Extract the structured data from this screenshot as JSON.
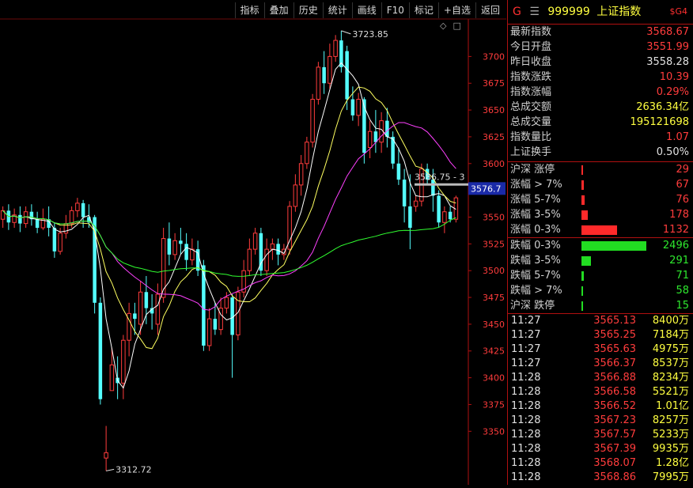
{
  "toolbar": {
    "buttons": [
      "指标",
      "叠加",
      "历史",
      "统计",
      "画线",
      "F10",
      "标记",
      "+自选",
      "返回"
    ]
  },
  "toolbar_icons": [
    "◇",
    "□"
  ],
  "chart": {
    "price_ticks": [
      "3700",
      "3675",
      "3650",
      "3625",
      "3600",
      "3575",
      "3550",
      "3525",
      "3500",
      "3475",
      "3450",
      "3425",
      "3400",
      "3375",
      "3350"
    ],
    "tick_values": [
      3700,
      3675,
      3650,
      3625,
      3600,
      3575,
      3550,
      3525,
      3500,
      3475,
      3450,
      3425,
      3400,
      3375,
      3350
    ],
    "high_label": "3723.85",
    "low_label": "3312.72",
    "cursor_label": "3586.75 - 3",
    "current_price_tag": "3576.7",
    "colors": {
      "up": "#ff3c3c",
      "down": "#54ffff",
      "ma5": "#ffffff",
      "ma10": "#ffff60",
      "ma20": "#ff40ff",
      "ma60": "#30ff30",
      "axis": "#b01010"
    }
  },
  "chart_data": {
    "type": "candlestick",
    "ylim": [
      3300,
      3735
    ],
    "candles": [
      [
        3548,
        3556,
        3540,
        3560
      ],
      [
        3556,
        3545,
        3538,
        3562
      ],
      [
        3545,
        3552,
        3540,
        3558
      ],
      [
        3552,
        3544,
        3536,
        3560
      ],
      [
        3544,
        3555,
        3540,
        3560
      ],
      [
        3555,
        3548,
        3542,
        3562
      ],
      [
        3548,
        3540,
        3535,
        3555
      ],
      [
        3540,
        3548,
        3538,
        3558
      ],
      [
        3548,
        3540,
        3532,
        3560
      ],
      [
        3540,
        3518,
        3512,
        3545
      ],
      [
        3518,
        3535,
        3515,
        3540
      ],
      [
        3535,
        3544,
        3530,
        3552
      ],
      [
        3544,
        3556,
        3540,
        3560
      ],
      [
        3556,
        3563,
        3550,
        3568
      ],
      [
        3563,
        3550,
        3540,
        3566
      ],
      [
        3550,
        3545,
        3540,
        3562
      ],
      [
        3550,
        3470,
        3460,
        3552
      ],
      [
        3470,
        3380,
        3375,
        3475
      ],
      [
        3325,
        3330,
        3313,
        3355
      ],
      [
        3388,
        3412,
        3398,
        3428
      ],
      [
        3400,
        3395,
        3380,
        3420
      ],
      [
        3395,
        3435,
        3380,
        3440
      ],
      [
        3435,
        3460,
        3420,
        3470
      ],
      [
        3460,
        3455,
        3440,
        3470
      ],
      [
        3450,
        3480,
        3440,
        3490
      ],
      [
        3480,
        3465,
        3450,
        3495
      ],
      [
        3465,
        3460,
        3445,
        3478
      ],
      [
        3450,
        3478,
        3440,
        3488
      ],
      [
        3475,
        3530,
        3470,
        3540
      ],
      [
        3530,
        3515,
        3505,
        3545
      ],
      [
        3515,
        3528,
        3510,
        3535
      ],
      [
        3528,
        3525,
        3515,
        3540
      ],
      [
        3525,
        3510,
        3500,
        3535
      ],
      [
        3510,
        3520,
        3505,
        3530
      ],
      [
        3520,
        3500,
        3495,
        3528
      ],
      [
        3505,
        3430,
        3425,
        3510
      ],
      [
        3430,
        3455,
        3425,
        3465
      ],
      [
        3455,
        3445,
        3440,
        3470
      ],
      [
        3445,
        3465,
        3440,
        3475
      ],
      [
        3465,
        3475,
        3460,
        3480
      ],
      [
        3475,
        3440,
        3400,
        3478
      ],
      [
        3440,
        3480,
        3435,
        3485
      ],
      [
        3480,
        3500,
        3475,
        3510
      ],
      [
        3500,
        3520,
        3495,
        3530
      ],
      [
        3520,
        3535,
        3515,
        3540
      ],
      [
        3535,
        3500,
        3495,
        3540
      ],
      [
        3500,
        3520,
        3495,
        3530
      ],
      [
        3520,
        3525,
        3510,
        3530
      ],
      [
        3525,
        3515,
        3505,
        3530
      ],
      [
        3515,
        3520,
        3510,
        3525
      ],
      [
        3520,
        3560,
        3515,
        3565
      ],
      [
        3560,
        3580,
        3555,
        3590
      ],
      [
        3580,
        3600,
        3570,
        3608
      ],
      [
        3600,
        3620,
        3595,
        3625
      ],
      [
        3620,
        3660,
        3615,
        3665
      ],
      [
        3660,
        3690,
        3655,
        3695
      ],
      [
        3690,
        3675,
        3665,
        3705
      ],
      [
        3675,
        3700,
        3670,
        3712
      ],
      [
        3700,
        3715,
        3695,
        3720
      ],
      [
        3715,
        3690,
        3685,
        3724
      ],
      [
        3705,
        3660,
        3650,
        3710
      ],
      [
        3660,
        3645,
        3640,
        3672
      ],
      [
        3645,
        3660,
        3635,
        3666
      ],
      [
        3660,
        3610,
        3600,
        3662
      ],
      [
        3615,
        3630,
        3605,
        3640
      ],
      [
        3630,
        3620,
        3610,
        3650
      ],
      [
        3620,
        3640,
        3610,
        3648
      ],
      [
        3640,
        3625,
        3615,
        3652
      ],
      [
        3625,
        3600,
        3595,
        3630
      ],
      [
        3600,
        3585,
        3580,
        3615
      ],
      [
        3585,
        3560,
        3545,
        3595
      ],
      [
        3560,
        3540,
        3520,
        3590
      ],
      [
        3560,
        3565,
        3555,
        3570
      ],
      [
        3565,
        3595,
        3560,
        3600
      ],
      [
        3595,
        3585,
        3580,
        3600
      ],
      [
        3585,
        3570,
        3555,
        3595
      ],
      [
        3570,
        3545,
        3540,
        3575
      ],
      [
        3545,
        3555,
        3535,
        3560
      ],
      [
        3555,
        3548,
        3545,
        3560
      ],
      [
        3548,
        3568,
        3545,
        3570
      ]
    ]
  },
  "panel": {
    "header": {
      "prefix": "G",
      "menu": "☰",
      "code": "999999",
      "name": "上证指数",
      "tag": "$G4"
    },
    "quotes": [
      {
        "label": "最新指数",
        "value": "3568.67",
        "color": "red"
      },
      {
        "label": "今日开盘",
        "value": "3551.99",
        "color": "red"
      },
      {
        "label": "昨日收盘",
        "value": "3558.28",
        "color": "white"
      },
      {
        "label": "指数涨跌",
        "value": "10.39",
        "color": "red"
      },
      {
        "label": "指数涨幅",
        "value": "0.29%",
        "color": "red"
      },
      {
        "label": "总成交额",
        "value": "2636.34亿",
        "color": "yellow"
      },
      {
        "label": "总成交量",
        "value": "195121698",
        "color": "yellow"
      },
      {
        "label": "指数量比",
        "value": "1.07",
        "color": "red"
      },
      {
        "label": "上证换手",
        "value": "0.50%",
        "color": "white"
      }
    ],
    "breadth": [
      {
        "label": "沪深 涨停",
        "value": "29",
        "fraction": 0.02,
        "color": "red"
      },
      {
        "label": "涨幅 > 7%",
        "value": "67",
        "fraction": 0.04,
        "color": "red"
      },
      {
        "label": "涨幅 5-7%",
        "value": "76",
        "fraction": 0.045,
        "color": "red"
      },
      {
        "label": "涨幅 3-5%",
        "value": "178",
        "fraction": 0.1,
        "color": "red"
      },
      {
        "label": "涨幅 0-3%",
        "value": "1132",
        "fraction": 0.55,
        "color": "red"
      },
      {
        "label": "跌幅 0-3%",
        "value": "2496",
        "fraction": 1.0,
        "color": "green"
      },
      {
        "label": "跌幅 3-5%",
        "value": "291",
        "fraction": 0.15,
        "color": "green"
      },
      {
        "label": "跌幅 5-7%",
        "value": "71",
        "fraction": 0.04,
        "color": "green"
      },
      {
        "label": "跌幅 > 7%",
        "value": "58",
        "fraction": 0.03,
        "color": "green"
      },
      {
        "label": "沪深 跌停",
        "value": "15",
        "fraction": 0.01,
        "color": "green"
      }
    ],
    "ticks": [
      {
        "time": "11:27",
        "price": "3565.13",
        "vol": "8400万"
      },
      {
        "time": "11:27",
        "price": "3565.25",
        "vol": "7184万"
      },
      {
        "time": "11:27",
        "price": "3565.63",
        "vol": "4975万"
      },
      {
        "time": "11:27",
        "price": "3566.37",
        "vol": "8537万"
      },
      {
        "time": "11:28",
        "price": "3566.88",
        "vol": "8234万"
      },
      {
        "time": "11:28",
        "price": "3566.58",
        "vol": "5521万"
      },
      {
        "time": "11:28",
        "price": "3566.52",
        "vol": "1.01亿"
      },
      {
        "time": "11:28",
        "price": "3567.23",
        "vol": "8257万"
      },
      {
        "time": "11:28",
        "price": "3567.57",
        "vol": "5233万"
      },
      {
        "time": "11:28",
        "price": "3567.39",
        "vol": "9935万"
      },
      {
        "time": "11:28",
        "price": "3568.07",
        "vol": "1.28亿"
      },
      {
        "time": "11:28",
        "price": "3568.86",
        "vol": "7995万"
      }
    ]
  }
}
